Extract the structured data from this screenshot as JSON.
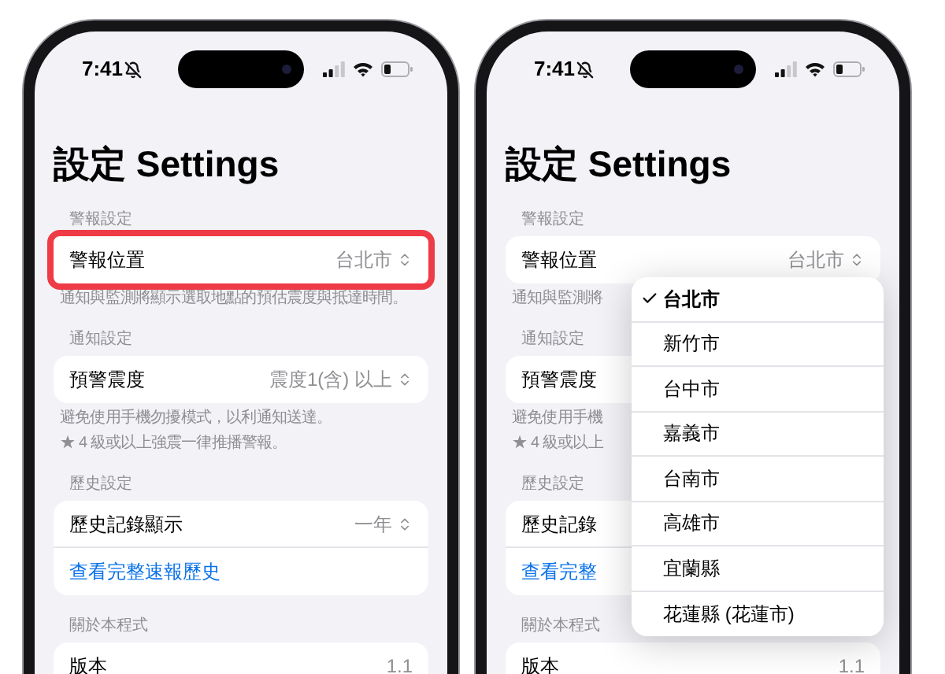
{
  "phones": [
    {
      "status_bar": {
        "time": "7:41"
      },
      "title": "設定 Settings",
      "sections": [
        {
          "header": "警報設定",
          "rows": [
            {
              "kind": "picker",
              "label": "警報位置",
              "value": "台北市",
              "highlighted": true
            }
          ],
          "footnotes": [
            "通知與監測將顯示選取地點的預估震度與抵達時間。"
          ]
        },
        {
          "header": "通知設定",
          "rows": [
            {
              "kind": "picker",
              "label": "預警震度",
              "value": "震度1(含) 以上",
              "highlighted": false
            }
          ],
          "footnotes": [
            "避免使用手機勿擾模式，以利通知送達。",
            "★ 4 級或以上強震一律推播警報。"
          ]
        },
        {
          "header": "歷史設定",
          "rows": [
            {
              "kind": "picker",
              "label": "歷史記錄顯示",
              "value": "一年",
              "highlighted": false
            },
            {
              "kind": "link",
              "label": "查看完整速報歷史"
            }
          ]
        },
        {
          "header": "關於本程式",
          "rows": [
            {
              "kind": "info",
              "label": "版本",
              "value": "1.1"
            }
          ]
        }
      ]
    },
    {
      "status_bar": {
        "time": "7:41"
      },
      "title": "設定 Settings",
      "sections": [
        {
          "header": "警報設定",
          "rows": [
            {
              "kind": "picker",
              "label": "警報位置",
              "value": "台北市",
              "highlighted": false
            }
          ],
          "footnotes": [
            "通知與監測將"
          ]
        },
        {
          "header": "通知設定",
          "rows": [
            {
              "kind": "picker",
              "label": "預警震度",
              "highlighted": false
            }
          ],
          "footnotes": [
            "避免使用手機",
            "★ 4 級或以上"
          ]
        },
        {
          "header": "歷史設定",
          "rows": [
            {
              "kind": "picker",
              "label": "歷史記錄",
              "highlighted": false
            },
            {
              "kind": "link",
              "label": "查看完整"
            }
          ]
        },
        {
          "header": "關於本程式",
          "rows": [
            {
              "kind": "info",
              "label": "版本",
              "value": "1.1"
            }
          ]
        }
      ],
      "menu": {
        "items": [
          {
            "label": "台北市",
            "selected": true
          },
          {
            "label": "新竹市",
            "selected": false
          },
          {
            "label": "台中市",
            "selected": false
          },
          {
            "label": "嘉義市",
            "selected": false
          },
          {
            "label": "台南市",
            "selected": false
          },
          {
            "label": "高雄市",
            "selected": false
          },
          {
            "label": "宜蘭縣",
            "selected": false
          },
          {
            "label": "花蓮縣 (花蓮市)",
            "selected": false
          }
        ]
      }
    }
  ]
}
